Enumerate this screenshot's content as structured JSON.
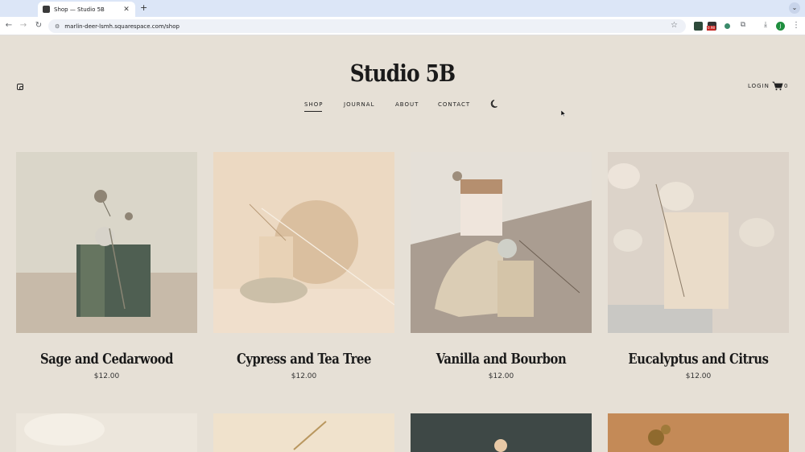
{
  "browser": {
    "tab_title": "Shop — Studio 5B",
    "new_tab": "+",
    "url": "marlin-deer-lsmh.squarespace.com/shop",
    "profile_initial": "J",
    "ext_badge": "0.98"
  },
  "site": {
    "title": "Studio 5B",
    "nav": [
      {
        "label": "SHOP",
        "active": true
      },
      {
        "label": "JOURNAL"
      },
      {
        "label": "ABOUT"
      },
      {
        "label": "CONTACT"
      }
    ],
    "login": "LOGIN",
    "cart_count": "0"
  },
  "products": [
    {
      "name": "Sage and Cedarwood",
      "price": "$12.00",
      "bg": "#d9d6c9"
    },
    {
      "name": "Cypress and Tea Tree",
      "price": "$12.00",
      "bg": "#ecd9c2"
    },
    {
      "name": "Vanilla and Bourbon",
      "price": "$12.00",
      "bg": "#cfc6ba"
    },
    {
      "name": "Eucalyptus and Citrus",
      "price": "$12.00",
      "bg": "#dcd3c9"
    }
  ],
  "products_row2_colors": [
    "#ece6dc",
    "#f0e2cc",
    "#3e4846",
    "#c48a57"
  ],
  "colors": {
    "page_bg": "#e6e0d6",
    "text": "#1a1a1a"
  }
}
